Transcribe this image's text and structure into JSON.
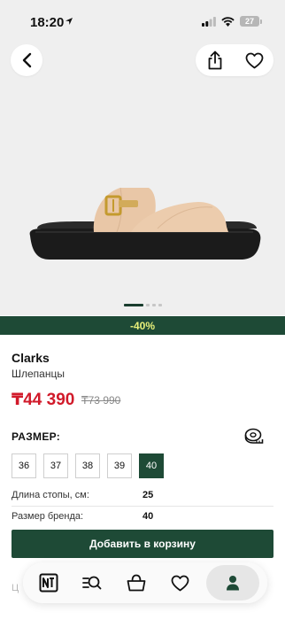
{
  "status_bar": {
    "time": "18:20",
    "battery": "27"
  },
  "header": {
    "back_icon": "chevron-left-icon",
    "share_icon": "share-icon",
    "favorite_icon": "heart-icon"
  },
  "gallery": {
    "total_images": 4,
    "active_index": 0
  },
  "product": {
    "discount": "-40%",
    "brand": "Clarks",
    "category": "Шлепанцы",
    "price": "₸44 390",
    "old_price": "₸73 990"
  },
  "sizes": {
    "title": "РАЗМЕР:",
    "ruler_icon": "measuring-tape-icon",
    "options": [
      "36",
      "37",
      "38",
      "39",
      "40"
    ],
    "selected": "40"
  },
  "specs": [
    {
      "label": "Длина стопы, см:",
      "value": "25"
    },
    {
      "label": "Размер бренда:",
      "value": "40"
    }
  ],
  "actions": {
    "add_to_cart": "Добавить в корзину"
  },
  "faded_text": "Ц",
  "bottom_nav": {
    "items": [
      {
        "name": "home",
        "icon": "logo-icon"
      },
      {
        "name": "search",
        "icon": "search-icon"
      },
      {
        "name": "cart",
        "icon": "basket-icon"
      },
      {
        "name": "favorites",
        "icon": "heart-icon"
      },
      {
        "name": "profile",
        "icon": "user-icon",
        "active": true
      }
    ]
  },
  "colors": {
    "accent": "#1e4a36",
    "discount_text": "#e8f07a",
    "price": "#d11a2a"
  }
}
